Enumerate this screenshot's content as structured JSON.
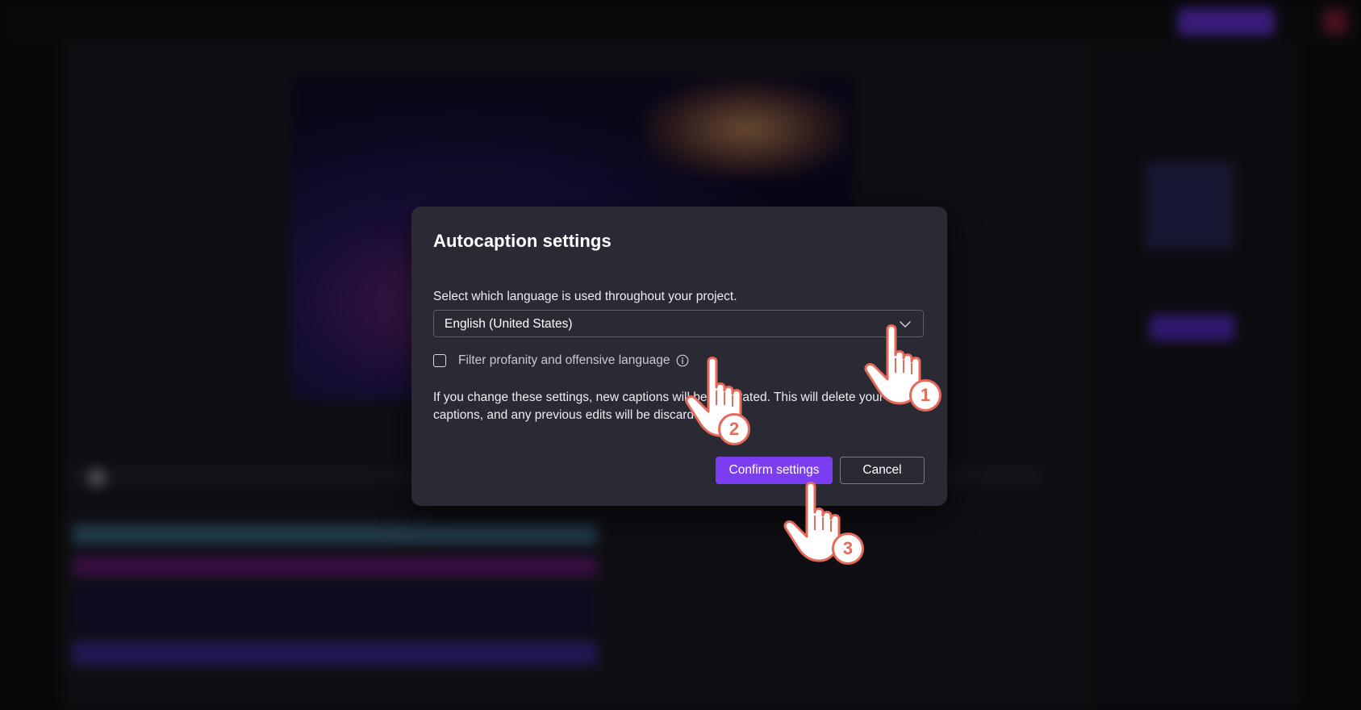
{
  "dialog": {
    "title": "Autocaption settings",
    "language_prompt": "Select which language is used throughout your project.",
    "language_select": {
      "selected": "English (United States)",
      "icon": "chevron-down-icon"
    },
    "profanity_filter": {
      "label": "Filter profanity and offensive language",
      "checked": false,
      "info_icon": "info-icon"
    },
    "warning": "If you change these settings, new captions will be generated. This will delete your current captions, and any previous edits will be discarded.",
    "buttons": {
      "confirm": "Confirm settings",
      "cancel": "Cancel"
    }
  },
  "tutorial_steps": [
    {
      "number": "1",
      "target": "language-select"
    },
    {
      "number": "2",
      "target": "profanity-checkbox"
    },
    {
      "number": "3",
      "target": "confirm-button"
    }
  ],
  "colors": {
    "accent": "#7c3cf0",
    "dialog_bg": "#2a2a34",
    "step_badge": "#e56a5a"
  }
}
